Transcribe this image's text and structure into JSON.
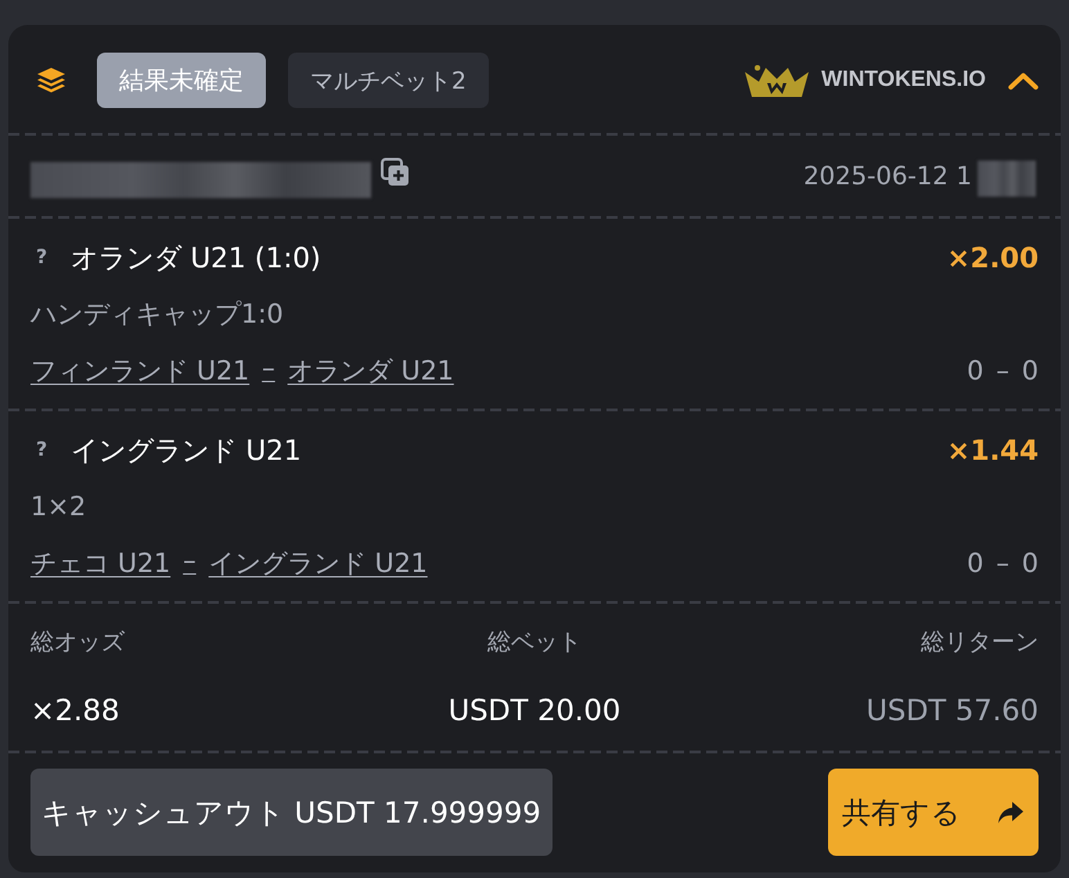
{
  "header": {
    "badges": [
      {
        "label": "結果未確定",
        "kind": "status"
      },
      {
        "label": "マルチベット2",
        "kind": "type"
      }
    ],
    "brand": "WINTOKENS.IO",
    "expanded": true
  },
  "ticket": {
    "date": "2025-06-12 1"
  },
  "selections": [
    {
      "mark": "?",
      "pick": "オランダ U21 (1:0)",
      "odds": "×2.00",
      "market": "ハンディキャップ1:0",
      "home": "フィンランド U21",
      "separator": "–",
      "away": "オランダ U21",
      "score": "0 – 0"
    },
    {
      "mark": "?",
      "pick": "イングランド U21",
      "odds": "×1.44",
      "market": "1×2",
      "home": "チェコ U21",
      "separator": "–",
      "away": "イングランド U21",
      "score": "0 – 0"
    }
  ],
  "totals": [
    {
      "label": "総オッズ",
      "value": "×2.88",
      "kind": "odds"
    },
    {
      "label": "総ベット",
      "value": "USDT 20.00",
      "kind": "stake"
    },
    {
      "label": "総リターン",
      "value": "USDT 57.60",
      "kind": "return"
    }
  ],
  "buttons": [
    {
      "label": "キャッシュアウト USDT 17.999999",
      "kind": "cashout"
    },
    {
      "label": "共有する",
      "kind": "share"
    }
  ]
}
